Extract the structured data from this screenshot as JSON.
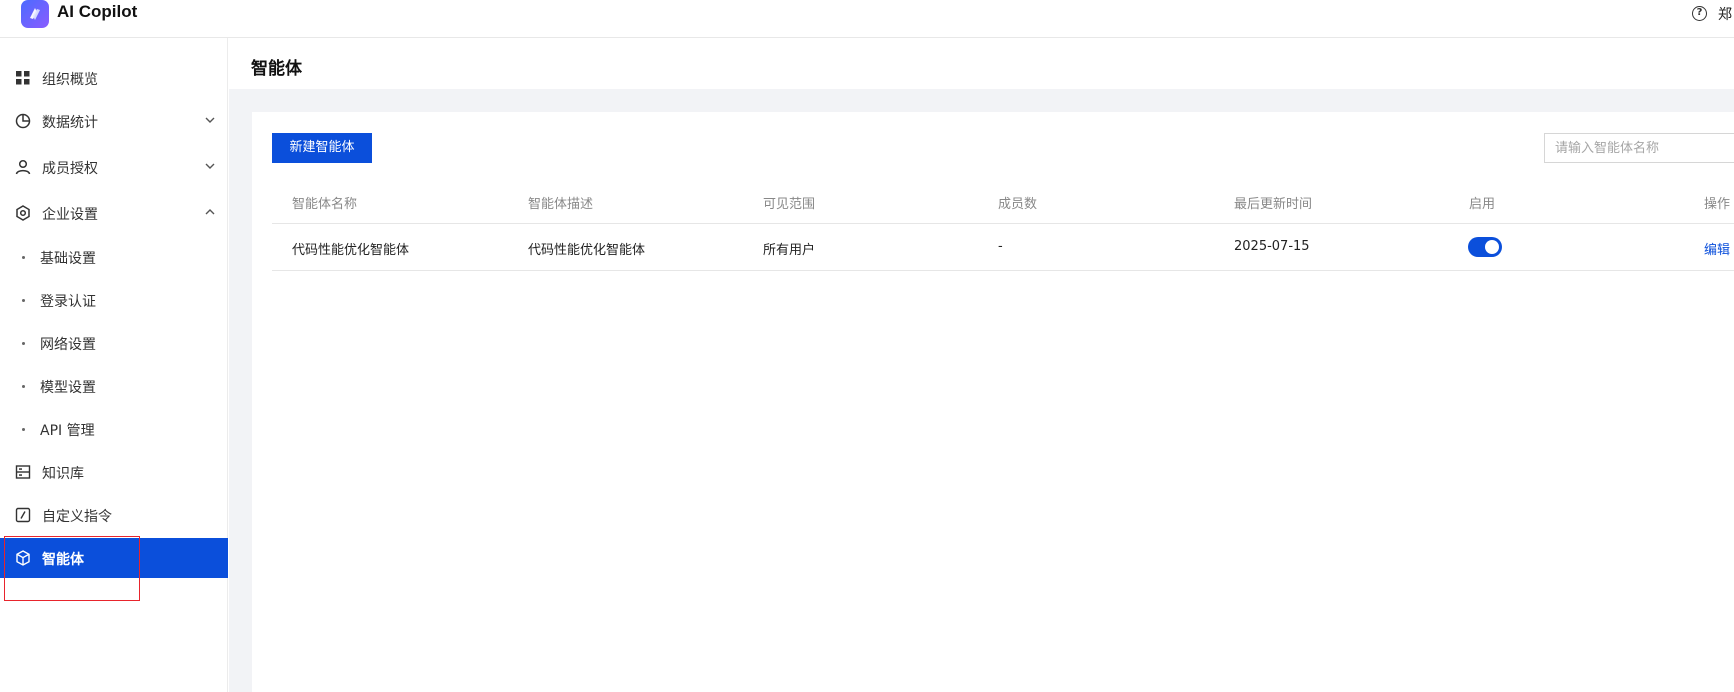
{
  "header": {
    "app_title": "AI Copilot",
    "help_glyph": "?",
    "user_name": "郑",
    "logo_icon": "copilot-logo-icon"
  },
  "sidebar": {
    "items": [
      {
        "label": "组织概览",
        "icon": "grid-icon"
      },
      {
        "label": "数据统计",
        "icon": "pie-chart-icon",
        "expandable": true,
        "expanded": false
      },
      {
        "label": "成员授权",
        "icon": "user-icon",
        "expandable": true,
        "expanded": false
      },
      {
        "label": "企业设置",
        "icon": "settings-icon",
        "expandable": true,
        "expanded": true
      },
      {
        "label": "知识库",
        "icon": "database-icon"
      },
      {
        "label": "自定义指令",
        "icon": "command-icon"
      },
      {
        "label": "智能体",
        "icon": "cube-icon",
        "active": true
      }
    ],
    "sub_items": [
      "基础设置",
      "登录认证",
      "网络设置",
      "模型设置",
      "API 管理"
    ]
  },
  "main": {
    "page_title": "智能体",
    "new_button_label": "新建智能体",
    "search_placeholder": "请输入智能体名称",
    "columns": [
      "智能体名称",
      "智能体描述",
      "可见范围",
      "成员数",
      "最后更新时间",
      "启用",
      "操作"
    ],
    "rows": [
      {
        "name": "代码性能优化智能体",
        "description": "代码性能优化智能体",
        "visibility": "所有用户",
        "members": "-",
        "updated": "2025-07-15",
        "enabled": true,
        "action": "编辑"
      }
    ]
  },
  "colors": {
    "accent": "#0b4fdb",
    "highlight_box": "#e8242c",
    "content_bg": "#f2f3f6"
  }
}
